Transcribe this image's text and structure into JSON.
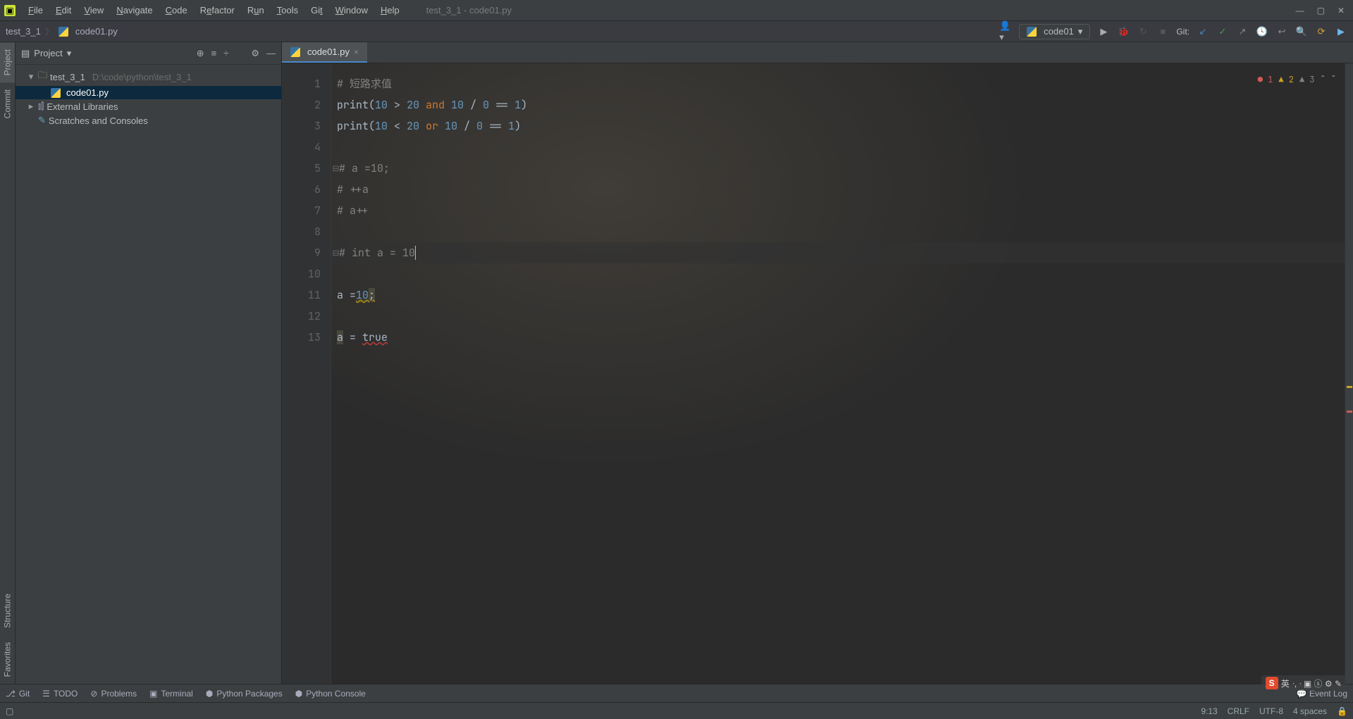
{
  "menu": [
    "File",
    "Edit",
    "View",
    "Navigate",
    "Code",
    "Refactor",
    "Run",
    "Tools",
    "Git",
    "Window",
    "Help"
  ],
  "menu_underline_idx": [
    0,
    0,
    0,
    0,
    0,
    1,
    1,
    0,
    2,
    0,
    0
  ],
  "window_title": "test_3_1 - code01.py",
  "breadcrumb": {
    "project": "test_3_1",
    "file": "code01.py"
  },
  "config_selected": "code01",
  "git_label": "Git:",
  "sidebar": {
    "title": "Project",
    "items": [
      {
        "indent": 0,
        "chev": "▾",
        "icon": "folder",
        "label": "test_3_1",
        "path": "D:\\code\\python\\test_3_1"
      },
      {
        "indent": 1,
        "chev": "",
        "icon": "py",
        "label": "code01.py",
        "selected": true
      },
      {
        "indent": 0,
        "chev": "▸",
        "icon": "lib",
        "label": "External Libraries"
      },
      {
        "indent": 0,
        "chev": "",
        "icon": "scratch",
        "label": "Scratches and Consoles"
      }
    ]
  },
  "tab": {
    "file": "code01.py"
  },
  "inspection": {
    "errors": "1",
    "warnings": "2",
    "weak": "3"
  },
  "code_lines": [
    {
      "n": 1,
      "segs": [
        {
          "t": "# 短路求值",
          "c": "c-com"
        }
      ]
    },
    {
      "n": 2,
      "segs": [
        {
          "t": "print",
          "c": "c-fn"
        },
        {
          "t": "(",
          "c": "c-op"
        },
        {
          "t": "10",
          "c": "c-num"
        },
        {
          "t": " > ",
          "c": "c-op"
        },
        {
          "t": "20",
          "c": "c-num"
        },
        {
          "t": " ",
          "c": ""
        },
        {
          "t": "and",
          "c": "c-kw"
        },
        {
          "t": " ",
          "c": ""
        },
        {
          "t": "10",
          "c": "c-num"
        },
        {
          "t": " / ",
          "c": "c-op"
        },
        {
          "t": "0",
          "c": "c-num"
        },
        {
          "t": " == ",
          "c": "c-op"
        },
        {
          "t": "1",
          "c": "c-num"
        },
        {
          "t": ")",
          "c": "c-op"
        }
      ]
    },
    {
      "n": 3,
      "segs": [
        {
          "t": "print",
          "c": "c-fn"
        },
        {
          "t": "(",
          "c": "c-op"
        },
        {
          "t": "10",
          "c": "c-num"
        },
        {
          "t": " < ",
          "c": "c-op"
        },
        {
          "t": "20",
          "c": "c-num"
        },
        {
          "t": " ",
          "c": ""
        },
        {
          "t": "or",
          "c": "c-kw"
        },
        {
          "t": " ",
          "c": ""
        },
        {
          "t": "10",
          "c": "c-num"
        },
        {
          "t": " / ",
          "c": "c-op"
        },
        {
          "t": "0",
          "c": "c-num"
        },
        {
          "t": " == ",
          "c": "c-op"
        },
        {
          "t": "1",
          "c": "c-num"
        },
        {
          "t": ")",
          "c": "c-op"
        }
      ]
    },
    {
      "n": 4,
      "segs": []
    },
    {
      "n": 5,
      "segs": [
        {
          "t": "# a =10;",
          "c": "c-com"
        }
      ],
      "fold": true
    },
    {
      "n": 6,
      "segs": [
        {
          "t": "# ++a",
          "c": "c-com"
        }
      ]
    },
    {
      "n": 7,
      "segs": [
        {
          "t": "# a++",
          "c": "c-com"
        }
      ]
    },
    {
      "n": 8,
      "segs": []
    },
    {
      "n": 9,
      "segs": [
        {
          "t": "# int a = 10",
          "c": "c-com"
        }
      ],
      "fold": true,
      "caret": true
    },
    {
      "n": 10,
      "segs": []
    },
    {
      "n": 11,
      "segs": [
        {
          "t": "a ",
          "c": "c-id"
        },
        {
          "t": "=",
          "c": "c-op"
        },
        {
          "t": "10",
          "c": "c-num c-warn"
        },
        {
          "t": ";",
          "c": "c-warn c-box"
        }
      ]
    },
    {
      "n": 12,
      "segs": []
    },
    {
      "n": 13,
      "segs": [
        {
          "t": "a",
          "c": "c-id c-box"
        },
        {
          "t": " = ",
          "c": "c-op"
        },
        {
          "t": "true",
          "c": "c-id c-err"
        }
      ]
    }
  ],
  "bottom_tools": [
    "Git",
    "TODO",
    "Problems",
    "Terminal",
    "Python Packages",
    "Python Console"
  ],
  "bottom_tool_icons": [
    "⎇",
    "☰",
    "⊘",
    "▣",
    "⬢",
    "⬢"
  ],
  "event_log": "Event Log",
  "status": {
    "pos": "9:13",
    "eol": "CRLF",
    "enc": "UTF-8",
    "indent": "4 spaces"
  },
  "left_tabs": [
    "Project",
    "Commit",
    "Structure",
    "Favorites"
  ],
  "ime": {
    "s": "S",
    "lang": "英"
  }
}
